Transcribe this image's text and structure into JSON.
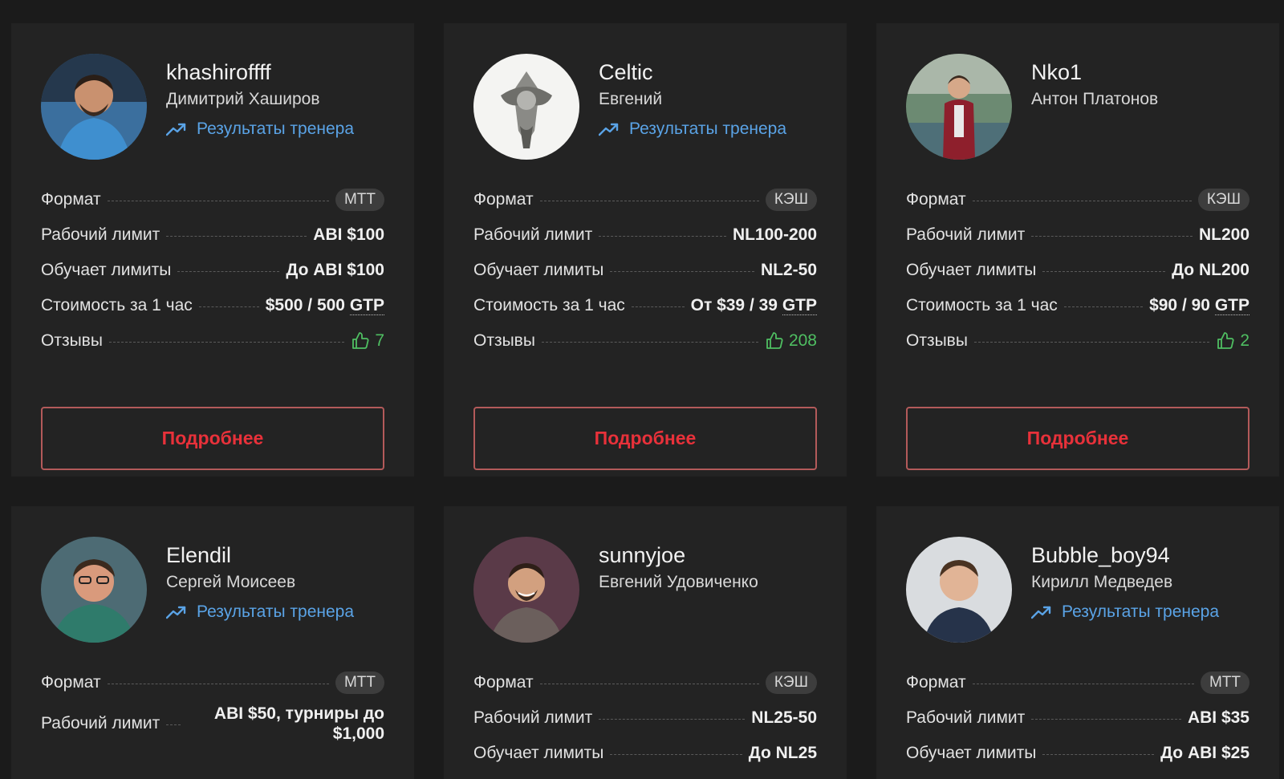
{
  "coaches": [
    {
      "nick": "khashiroffff",
      "name": "Димитрий Хаширов",
      "results": "Результаты тренера",
      "format_label": "Формат",
      "format": "МТТ",
      "limit_label": "Рабочий лимит",
      "limit": "ABI $100",
      "teaches_label": "Обучает лимиты",
      "teaches": "До ABI $100",
      "price_label": "Стоимость за 1 час",
      "price": "$500 / 500",
      "price_unit": "GTP",
      "reviews_label": "Отзывы",
      "reviews": "7",
      "button": "Подробнее"
    },
    {
      "nick": "Celtic",
      "name": "Евгений",
      "results": "Результаты тренера",
      "format_label": "Формат",
      "format": "КЭШ",
      "limit_label": "Рабочий лимит",
      "limit": "NL100-200",
      "teaches_label": "Обучает лимиты",
      "teaches": "NL2-50",
      "price_label": "Стоимость за 1 час",
      "price": "От $39 / 39",
      "price_unit": "GTP",
      "reviews_label": "Отзывы",
      "reviews": "208",
      "button": "Подробнее"
    },
    {
      "nick": "Nko1",
      "name": "Антон Платонов",
      "format_label": "Формат",
      "format": "КЭШ",
      "limit_label": "Рабочий лимит",
      "limit": "NL200",
      "teaches_label": "Обучает лимиты",
      "teaches": "До NL200",
      "price_label": "Стоимость за 1 час",
      "price": "$90 / 90",
      "price_unit": "GTP",
      "reviews_label": "Отзывы",
      "reviews": "2",
      "button": "Подробнее"
    },
    {
      "nick": "Elendil",
      "name": "Сергей Моисеев",
      "results": "Результаты тренера",
      "format_label": "Формат",
      "format": "МТТ",
      "limit_label": "Рабочий лимит",
      "limit": "ABI $50, турниры до $1,000"
    },
    {
      "nick": "sunnyjoe",
      "name": "Евгений Удовиченко",
      "format_label": "Формат",
      "format": "КЭШ",
      "limit_label": "Рабочий лимит",
      "limit": "NL25-50",
      "teaches_label": "Обучает лимиты",
      "teaches": "До NL25"
    },
    {
      "nick": "Bubble_boy94",
      "name": "Кирилл Медведев",
      "results": "Результаты тренера",
      "format_label": "Формат",
      "format": "МТТ",
      "limit_label": "Рабочий лимит",
      "limit": "ABI $35",
      "teaches_label": "Обучает лимиты",
      "teaches": "До ABI $25"
    }
  ],
  "colors": {
    "accent_blue": "#5aa3e6",
    "button_red": "#e8313a",
    "reviews_green": "#4fbf62",
    "card_bg": "#232323",
    "page_bg": "#1b1b1b"
  },
  "icons": {
    "results": "trending-up-icon",
    "reviews": "thumbs-up-icon"
  }
}
